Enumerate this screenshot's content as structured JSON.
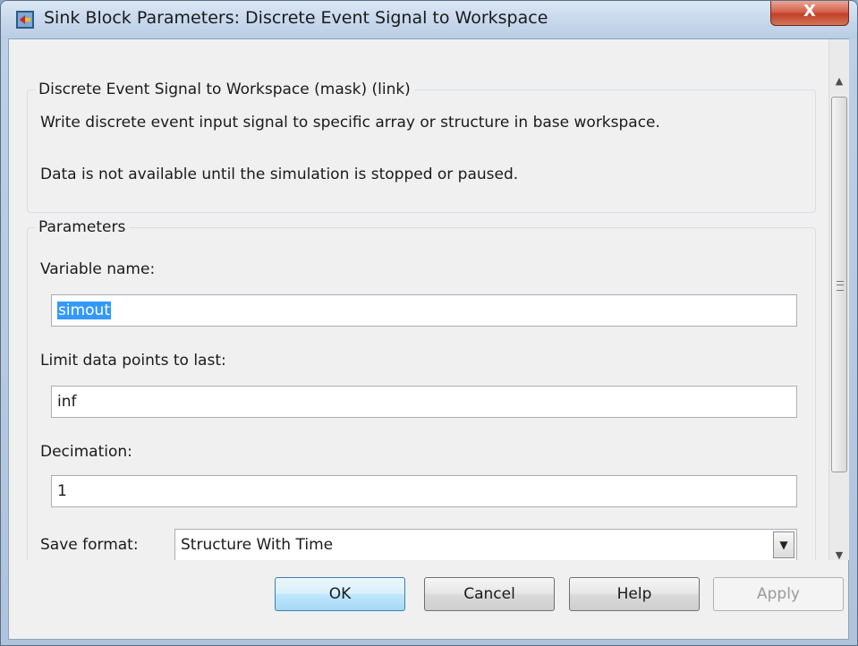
{
  "window": {
    "title": "Sink Block Parameters: Discrete Event Signal to Workspace",
    "close_label": "X"
  },
  "description_group": {
    "legend": "Discrete Event Signal to Workspace (mask) (link)",
    "lines": [
      "Write discrete event input signal to specific array or structure in base workspace.",
      "Data is not available until the simulation is stopped or paused."
    ]
  },
  "parameters_group": {
    "legend": "Parameters",
    "variable_name": {
      "label": "Variable name:",
      "value": "simout"
    },
    "limit_points": {
      "label": "Limit data points to last:",
      "value": "inf"
    },
    "decimation": {
      "label": "Decimation:",
      "value": "1"
    },
    "save_format": {
      "label": "Save format:",
      "value": "Structure With Time"
    }
  },
  "buttons": {
    "ok": "OK",
    "cancel": "Cancel",
    "help": "Help",
    "apply": "Apply"
  },
  "icons": {
    "app": "simulink-block-icon",
    "scroll_up": "arrow-up-icon",
    "scroll_down": "arrow-down-icon",
    "dropdown": "chevron-down-icon"
  },
  "colors": {
    "selection": "#3399ff",
    "close_button": "#c9442f",
    "default_button": "#bee6fd"
  }
}
